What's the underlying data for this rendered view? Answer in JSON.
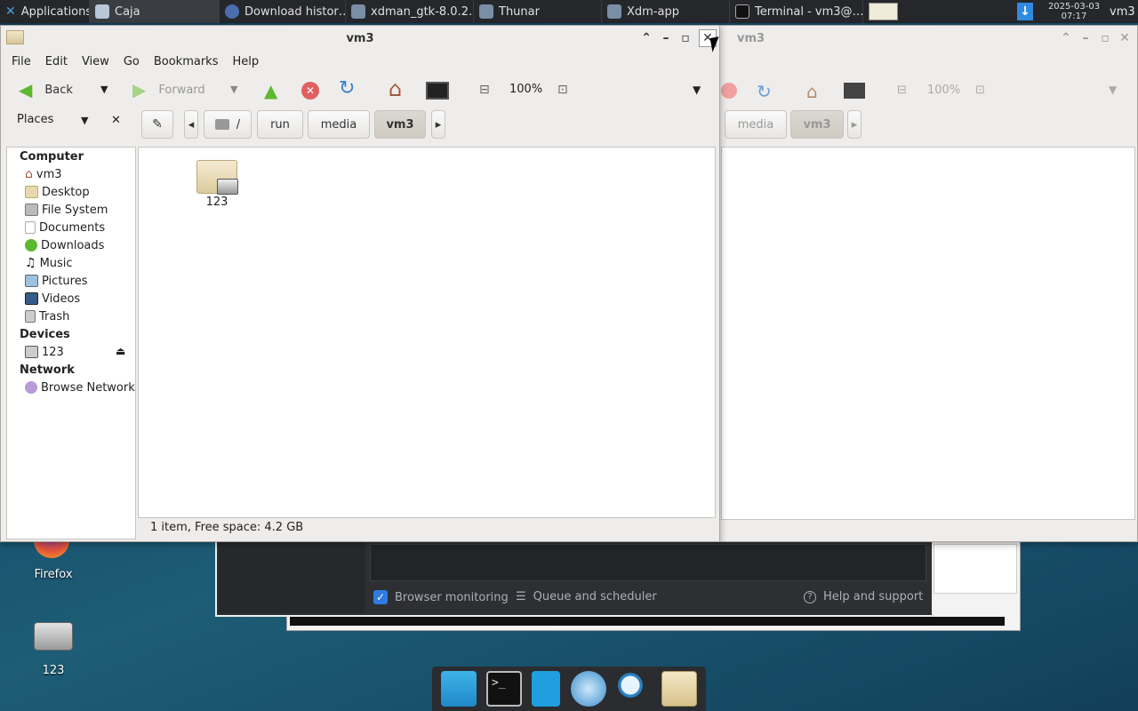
{
  "panel": {
    "apps_label": "Applications",
    "tasks": [
      {
        "label": "Caja",
        "icon": "caja-icon"
      },
      {
        "label": "Download histor…",
        "icon": "browser-icon"
      },
      {
        "label": "xdman_gtk-8.0.2…",
        "icon": "xdman-icon"
      },
      {
        "label": "Thunar",
        "icon": "thunar-icon"
      },
      {
        "label": "Xdm-app",
        "icon": "xdm-icon"
      },
      {
        "label": "Terminal - vm3@…",
        "icon": "terminal-icon"
      }
    ],
    "date": "2025-03-03",
    "time": "07:17",
    "user": "vm3"
  },
  "desktop": {
    "icons": [
      {
        "label": "Firefox",
        "icon": "firefox-icon"
      },
      {
        "label": "123",
        "icon": "drive-icon"
      }
    ]
  },
  "xdm": {
    "browser_monitoring": "Browser monitoring",
    "queue": "Queue and scheduler",
    "help": "Help and support"
  },
  "main_window": {
    "title": "vm3",
    "menu": [
      "File",
      "Edit",
      "View",
      "Go",
      "Bookmarks",
      "Help"
    ],
    "toolbar": {
      "back": "Back",
      "forward": "Forward",
      "zoom": "100%"
    },
    "places_label": "Places",
    "breadcrumbs": [
      "/",
      "run",
      "media",
      "vm3"
    ],
    "sidebar": {
      "computer_header": "Computer",
      "computer_items": [
        {
          "label": "vm3",
          "icon": "home-icon"
        },
        {
          "label": "Desktop",
          "icon": "desktop-folder-icon"
        },
        {
          "label": "File System",
          "icon": "filesystem-icon"
        },
        {
          "label": "Documents",
          "icon": "documents-icon"
        },
        {
          "label": "Downloads",
          "icon": "downloads-icon"
        },
        {
          "label": "Music",
          "icon": "music-icon"
        },
        {
          "label": "Pictures",
          "icon": "pictures-icon"
        },
        {
          "label": "Videos",
          "icon": "videos-icon"
        },
        {
          "label": "Trash",
          "icon": "trash-icon"
        }
      ],
      "devices_header": "Devices",
      "device_items": [
        {
          "label": "123",
          "icon": "drive-icon"
        }
      ],
      "network_header": "Network",
      "network_items": [
        {
          "label": "Browse Network",
          "icon": "network-icon"
        }
      ]
    },
    "files": [
      {
        "name": "123",
        "icon": "folder-drive-icon"
      }
    ],
    "status": "1 item, Free space: 4.2 GB"
  },
  "second_window": {
    "title": "vm3",
    "zoom": "100%",
    "breadcrumbs": [
      "media",
      "vm3"
    ]
  }
}
